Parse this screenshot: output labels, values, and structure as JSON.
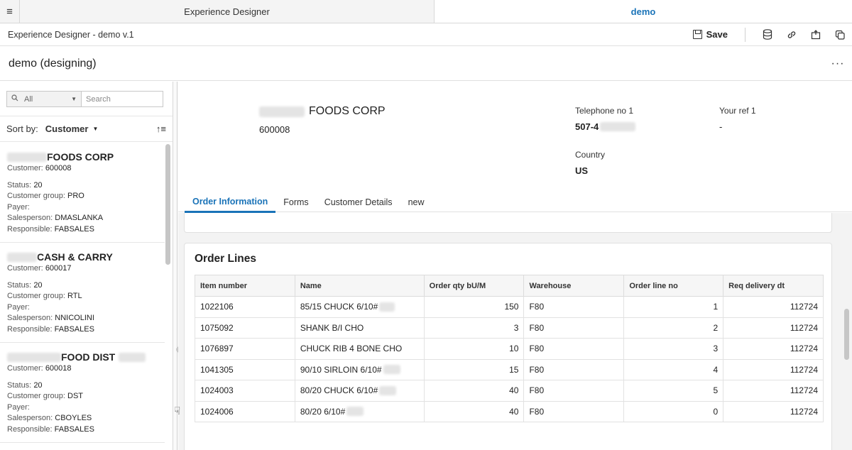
{
  "tabs": {
    "left": "Experience Designer",
    "right": "demo"
  },
  "breadcrumb": "Experience Designer - demo v.1",
  "toolbar": {
    "save_label": "Save",
    "icons": [
      "database-icon",
      "link-icon",
      "export-icon",
      "copy-icon"
    ]
  },
  "page_title": "demo (designing)",
  "more_label": "···",
  "filter": {
    "selected": "All",
    "search_placeholder": "Search"
  },
  "sort": {
    "label": "Sort by:",
    "value": "Customer"
  },
  "customers": [
    {
      "name": "FOODS CORP",
      "customer": "600008",
      "status": "20",
      "group": "PRO",
      "payer": "",
      "salesperson": "DMASLANKA",
      "responsible": "FABSALES"
    },
    {
      "name": "CASH & CARRY",
      "customer": "600017",
      "status": "20",
      "group": "RTL",
      "payer": "",
      "salesperson": "NNICOLINI",
      "responsible": "FABSALES"
    },
    {
      "name": "FOOD DIST",
      "customer": "600018",
      "status": "20",
      "group": "DST",
      "payer": "",
      "salesperson": "CBOYLES",
      "responsible": "FABSALES"
    }
  ],
  "labels": {
    "customer": "Customer:",
    "status": "Status:",
    "group": "Customer group:",
    "payer": "Payer:",
    "salesperson": "Salesperson:",
    "responsible": "Responsible:"
  },
  "header": {
    "name": "FOODS CORP",
    "number": "600008",
    "telephone_label": "Telephone no 1",
    "telephone_value": "507-4",
    "yourref_label": "Your ref 1",
    "yourref_value": "-",
    "country_label": "Country",
    "country_value": "US"
  },
  "content_tabs": [
    "Order Information",
    "Forms",
    "Customer Details",
    "new"
  ],
  "order_lines": {
    "title": "Order Lines",
    "columns": [
      "Item number",
      "Name",
      "Order qty bU/M",
      "Warehouse",
      "Order line no",
      "Req delivery dt"
    ],
    "rows": [
      [
        "1022106",
        "85/15 CHUCK 6/10#",
        "150",
        "F80",
        "1",
        "112724"
      ],
      [
        "1075092",
        "SHANK B/I CHO",
        "3",
        "F80",
        "2",
        "112724"
      ],
      [
        "1076897",
        "CHUCK RIB 4 BONE CHO",
        "10",
        "F80",
        "3",
        "112724"
      ],
      [
        "1041305",
        "90/10 SIRLOIN 6/10#",
        "15",
        "F80",
        "4",
        "112724"
      ],
      [
        "1024003",
        "80/20 CHUCK 6/10#",
        "40",
        "F80",
        "5",
        "112724"
      ],
      [
        "1024006",
        "80/20 6/10#",
        "40",
        "F80",
        "0",
        "112724"
      ]
    ]
  }
}
